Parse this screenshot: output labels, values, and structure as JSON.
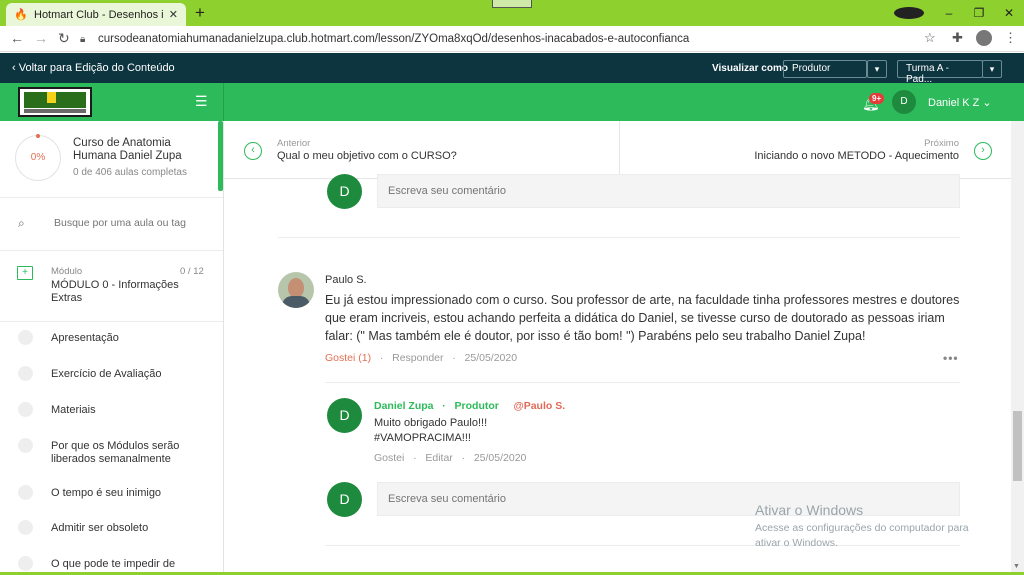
{
  "browser": {
    "tab_title": "Hotmart Club - Desenhos inacab",
    "tab_icon": "flame-icon",
    "new_tab": "+",
    "url": "cursodeanatomiahumanadanielzupa.club.hotmart.com/lesson/ZYOma8xqOd/desenhos-inacabados-e-autoconfianca",
    "win_min": "–",
    "win_max": "❐",
    "win_close": "✕"
  },
  "preview": {
    "back_label": "Voltar para Edição do Conteúdo",
    "view_as_label": "Visualizar como",
    "role_select": "Produtor",
    "class_select": "Turma A - Pad..."
  },
  "header": {
    "notif_badge": "9+",
    "user_initial": "D",
    "user_name": "Daniel K Z"
  },
  "sidebar": {
    "progress": "0%",
    "course_title": "Curso de Anatomia Humana Daniel Zupa",
    "course_sub": "0 de 406 aulas completas",
    "search_placeholder": "Busque por uma aula ou tag",
    "module_label": "Módulo",
    "module_count": "0 / 12",
    "module_title": "MÓDULO 0 - Informações Extras",
    "lessons": [
      "Apresentação",
      "Exercício de Avaliação",
      "Materiais",
      "Por que os Módulos serão liberados semanalmente",
      "O tempo é seu inimigo",
      "Admitir ser obsoleto",
      "O que pode te impedir de"
    ]
  },
  "lesson_nav": {
    "prev_label": "Anterior",
    "prev_title": "Qual o meu objetivo com o CURSO?",
    "next_label": "Próximo",
    "next_title": "Iniciando o novo METODO - Aquecimento"
  },
  "comments": {
    "input_placeholder": "Escreva seu comentário",
    "current_user_initial": "D",
    "c1": {
      "author": "Paulo S.",
      "text": "Eu já estou impressionado com o curso. Sou professor de arte, na faculdade  tinha professores mestres e doutores que eram incriveis, estou achando perfeita a didática do Daniel, se tivesse curso de doutorado as pessoas iriam falar: (\" Mas também ele é doutor, por isso é tão bom! \") Parabéns pelo seu trabalho Daniel Zupa!",
      "like": "Gostei (1)",
      "reply": "Responder",
      "date": "25/05/2020",
      "more": "•••"
    },
    "r1": {
      "author": "Daniel Zupa",
      "role": "Produtor",
      "mention": "@Paulo S.",
      "line1": "Muito obrigado Paulo!!!",
      "line2": "#VAMOPRACIMA!!!",
      "like": "Gostei",
      "edit": "Editar",
      "date": "25/05/2020"
    }
  },
  "windows": {
    "title": "Ativar o Windows",
    "subtitle": "Acesse as configurações do computador para ativar o Windows."
  },
  "colors": {
    "brand_green": "#2dba5a",
    "dark_bar": "#0d3540",
    "accent_red": "#e46f52"
  }
}
